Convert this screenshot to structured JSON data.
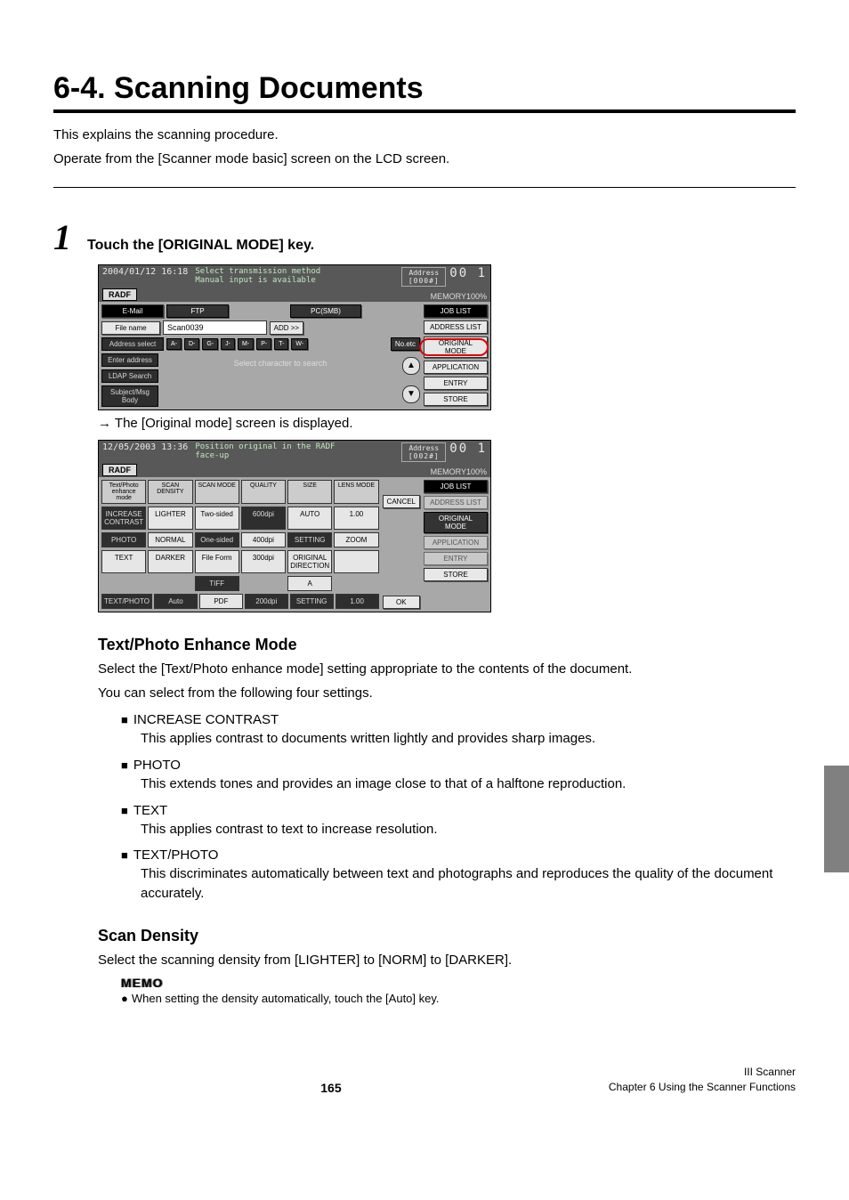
{
  "title": "6-4. Scanning Documents",
  "intro1": "This explains the scanning procedure.",
  "intro2": "Operate from the [Scanner mode basic] screen on the LCD screen.",
  "step1": {
    "num": "1",
    "text": "Touch the [ORIGINAL MODE] key."
  },
  "shot1": {
    "datetime": "2004/01/12 16:18",
    "msg1": "Select transmission method",
    "msg2": "Manual input is available",
    "radf": "RADF",
    "addr_label": "Address",
    "addr_count": "[000#]",
    "digits": "00 1",
    "memory": "MEMORY100%",
    "tabs": {
      "email": "E-Mail",
      "ftp": "FTP",
      "pcsmb": "PC(SMB)"
    },
    "joblist": "JOB LIST",
    "filename_label": "File name",
    "filename_value": "Scan0039",
    "add": "ADD >>",
    "address_list": "ADDRESS LIST",
    "addr_select": "Address select",
    "alpha": [
      "A-",
      "D-",
      "G-",
      "J-",
      "M-",
      "P-",
      "T-",
      "W-"
    ],
    "noetc": "No.etc",
    "original_mode": "ORIGINAL MODE",
    "enter_address": "Enter address",
    "application": "APPLICATION",
    "ldap": "LDAP Search",
    "entry": "ENTRY",
    "subject": "Subject/Msg Body",
    "store": "STORE",
    "center": "Select character to search"
  },
  "arrow_text": "The [Original mode] screen is displayed.",
  "shot2": {
    "datetime": "12/05/2003 13:36",
    "msg1": "Position original in the RADF",
    "msg2": "face-up",
    "radf": "RADF",
    "addr_label": "Address",
    "addr_count": "[002#]",
    "digits": "00 1",
    "memory": "MEMORY100%",
    "joblist": "JOB LIST",
    "address_list": "ADDRESS LIST",
    "original_mode": "ORIGINAL MODE",
    "application": "APPLICATION",
    "entry": "ENTRY",
    "store": "STORE",
    "cancel": "CANCEL",
    "ok": "OK",
    "headers": [
      "Text/Photo\nenhance mode",
      "SCAN DENSITY",
      "SCAN MODE",
      "QUALITY",
      "SIZE",
      "LENS MODE"
    ],
    "modes": {
      "contrast": "INCREASE\nCONTRAST",
      "photo": "PHOTO",
      "text": "TEXT",
      "textphoto": "TEXT/PHOTO"
    },
    "density": {
      "lighter": "LIGHTER",
      "normal": "NORMAL",
      "darker": "DARKER",
      "auto": "Auto"
    },
    "scanmode": {
      "two": "Two-sided",
      "one": "One-sided",
      "file": "File Form",
      "tiff": "TIFF",
      "pdf": "PDF"
    },
    "quality": {
      "q600": "600dpi",
      "q400": "400dpi",
      "q300": "300dpi",
      "q200": "200dpi"
    },
    "size": {
      "auto": "AUTO",
      "setting1": "SETTING",
      "origdir": "ORIGINAL\nDIRECTION",
      "a1": "A",
      "a2": "A",
      "setting2": "SETTING"
    },
    "lens": {
      "v100": "1.00",
      "zoom": "ZOOM",
      "blank": "",
      "v1": "1.00"
    }
  },
  "tp_head": "Text/Photo Enhance Mode",
  "tp_p1": "Select the [Text/Photo enhance mode] setting appropriate to the contents of the document.",
  "tp_p2": "You can select from the following four settings.",
  "bullets": [
    {
      "t": "INCREASE CONTRAST",
      "d": "This applies contrast to documents written lightly and provides sharp images."
    },
    {
      "t": "PHOTO",
      "d": "This extends tones and provides an image close to that of a halftone reproduction."
    },
    {
      "t": "TEXT",
      "d": "This applies contrast to text to increase resolution."
    },
    {
      "t": "TEXT/PHOTO",
      "d": "This discriminates automatically between text and photographs and reproduces the quality of the document accurately."
    }
  ],
  "sd_head": "Scan Density",
  "sd_p": "Select the scanning density from [LIGHTER] to [NORM] to [DARKER].",
  "memo_label": "MEMO",
  "memo_item": "When setting the density automatically, touch the [Auto] key.",
  "footer": {
    "page": "165",
    "l1": "III Scanner",
    "l2": "Chapter 6 Using the Scanner Functions"
  }
}
